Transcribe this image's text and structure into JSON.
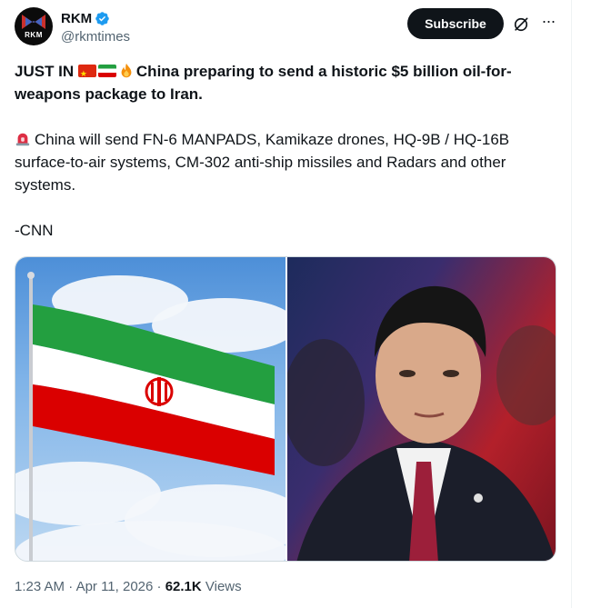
{
  "account": {
    "display_name": "RKM",
    "handle": "@rkmtimes",
    "avatar_text": "RKM",
    "verified_icon": "verified-badge-icon",
    "verified_color": "#1d9bf0"
  },
  "actions": {
    "subscribe_label": "Subscribe",
    "grok_icon": "grok-icon",
    "more_icon": "more-icon",
    "more_glyph": "···"
  },
  "tweet": {
    "headline_prefix": "JUST IN ",
    "headline_text": "China preparing to send a historic $5 billion oil-for-weapons package to Iran.",
    "body_text": "China will send FN-6 MANPADS, Kamikaze drones, HQ-9B / HQ-16B surface-to-air systems, CM-302 anti-ship missiles and Radars and other systems.",
    "source": "-CNN",
    "emoji": [
      "china-flag",
      "iran-flag",
      "fire",
      "siren"
    ]
  },
  "media": {
    "left_image": "iranian-flag-photo",
    "right_image": "xi-jinping-portrait-photo"
  },
  "meta": {
    "time": "1:23 AM",
    "sep1": " · ",
    "date": "Apr 11, 2026",
    "sep2": " · ",
    "views_count": "62.1K",
    "views_label": " Views"
  },
  "colors": {
    "text": "#0f1419",
    "muted": "#536471",
    "button_bg": "#0f1419",
    "border": "#cfd9de"
  }
}
